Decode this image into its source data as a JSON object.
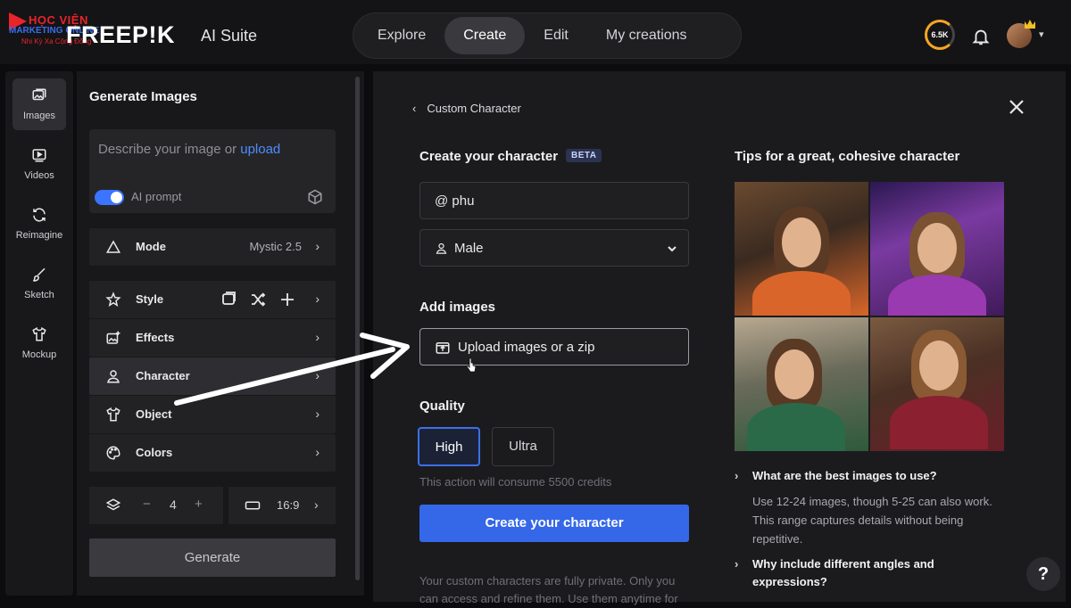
{
  "brand": {
    "watermark_line1": "HỌC VIỆN",
    "watermark_line2": "MARKETING ONLINE",
    "watermark_line3": "Nhi Kỳ Xa Cộng Đồng",
    "logo": "FREEP!K",
    "suite": "AI Suite"
  },
  "nav": {
    "tabs": [
      "Explore",
      "Create",
      "Edit",
      "My creations"
    ],
    "active": "Create"
  },
  "header": {
    "credits": "6.5K"
  },
  "sidebar": {
    "items": [
      {
        "label": "Images",
        "icon": "image-icon"
      },
      {
        "label": "Videos",
        "icon": "video-icon"
      },
      {
        "label": "Reimagine",
        "icon": "refresh-icon"
      },
      {
        "label": "Sketch",
        "icon": "brush-icon"
      },
      {
        "label": "Mockup",
        "icon": "shirt-icon"
      }
    ],
    "active": "Images"
  },
  "panel": {
    "title": "Generate Images",
    "prompt_placeholder": "Describe your image or ",
    "prompt_link": "upload",
    "ai_prompt_label": "AI prompt",
    "mode": {
      "label": "Mode",
      "value": "Mystic 2.5"
    },
    "options": [
      "Style",
      "Effects",
      "Character",
      "Object",
      "Colors"
    ],
    "count": "4",
    "aspect": "16:9",
    "generate": "Generate"
  },
  "main": {
    "back_label": "Custom Character",
    "heading": "Create your character",
    "beta": "BETA",
    "name_value": "@ phu",
    "gender_value": "Male",
    "add_images_heading": "Add images",
    "upload_label": "Upload images or a zip",
    "quality_heading": "Quality",
    "quality_options": [
      "High",
      "Ultra"
    ],
    "quality_selected": "High",
    "consume_text": "This action will consume 5500 credits",
    "create_button": "Create your character",
    "private_note": "Your custom characters are fully private. Only you can access and refine them. Use them anytime for"
  },
  "tips": {
    "heading": "Tips for a great, cohesive character",
    "q1": "What are the best images to use?",
    "a1": "Use 12-24 images, though 5-25 can also work. This range captures details without being repetitive.",
    "q2_line1": "Why include different angles and",
    "q2_line2": "expressions?"
  },
  "help_label": "?"
}
